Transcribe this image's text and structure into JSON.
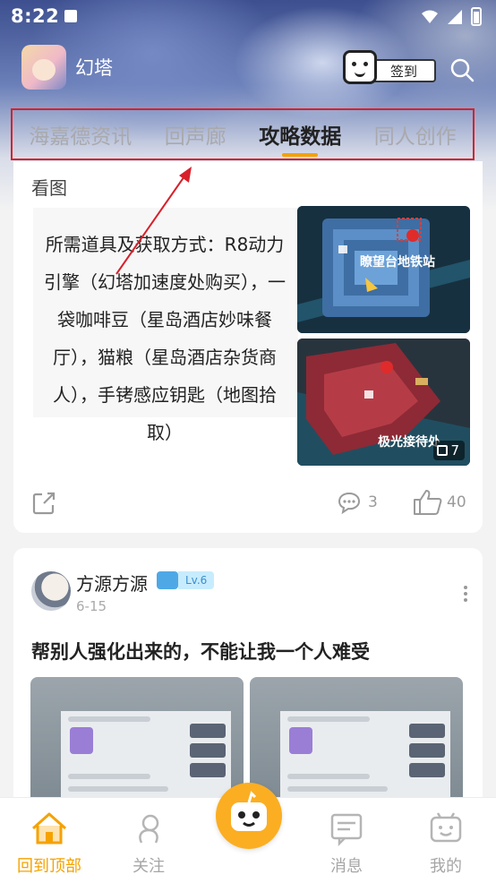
{
  "status_bar": {
    "time": "8:22"
  },
  "header": {
    "app_name": "幻塔",
    "checkin_label": "签到"
  },
  "tabs": [
    {
      "label": "海嘉德资讯",
      "active": false
    },
    {
      "label": "回声廊",
      "active": false
    },
    {
      "label": "攻略数据",
      "active": true
    },
    {
      "label": "同人创作",
      "active": false
    }
  ],
  "post1": {
    "section_label": "看图",
    "text": "所需道具及获取方式：R8动力引擎（幻塔加速度处购买），一袋咖啡豆（星岛酒店妙味餐厅），猫粮（星岛酒店杂货商人），手铐感应钥匙（地图拾取）",
    "images": [
      {
        "caption": "瞭望台地铁站"
      },
      {
        "caption": "极光接待处"
      }
    ],
    "image_count": "7",
    "comments": "3",
    "likes": "40"
  },
  "post2": {
    "author": "方源方源",
    "level": "Lv.6",
    "date": "6-15",
    "title": "帮别人强化出来的，不能让我一个人难受"
  },
  "bottom_nav": [
    {
      "label": "回到顶部",
      "icon": "home-icon",
      "active": true
    },
    {
      "label": "关注",
      "icon": "follow-icon",
      "active": false
    },
    {
      "label": "消息",
      "icon": "message-icon",
      "active": false
    },
    {
      "label": "我的",
      "icon": "profile-icon",
      "active": false
    }
  ],
  "colors": {
    "accent": "#f5a200",
    "highlight_box": "#d8202a",
    "fab": "#fbae22"
  }
}
